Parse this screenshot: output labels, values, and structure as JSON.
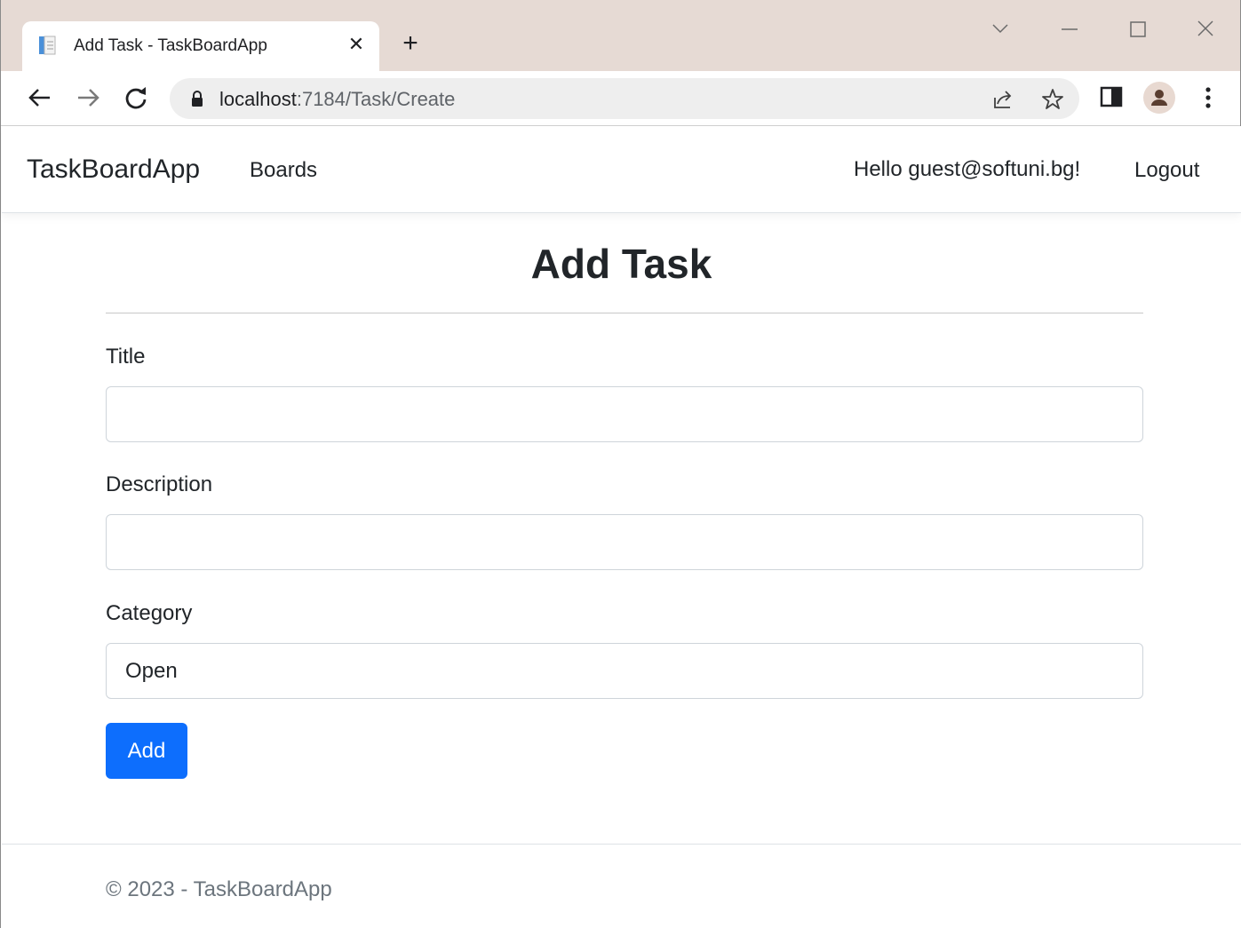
{
  "browser": {
    "tab_title": "Add Task - TaskBoardApp",
    "url_host": "localhost",
    "url_path": ":7184/Task/Create",
    "tab_close": "✕",
    "new_tab": "+"
  },
  "navbar": {
    "brand": "TaskBoardApp",
    "boards_label": "Boards",
    "greeting": "Hello guest@softuni.bg!",
    "logout_label": "Logout"
  },
  "form": {
    "heading": "Add Task",
    "title_label": "Title",
    "title_value": "",
    "description_label": "Description",
    "description_value": "",
    "category_label": "Category",
    "category_value": "Open",
    "submit_label": "Add"
  },
  "footer": {
    "text": "© 2023 - TaskBoardApp"
  },
  "colors": {
    "primary": "#0d6efd",
    "titlebar": "#e6dad4"
  }
}
